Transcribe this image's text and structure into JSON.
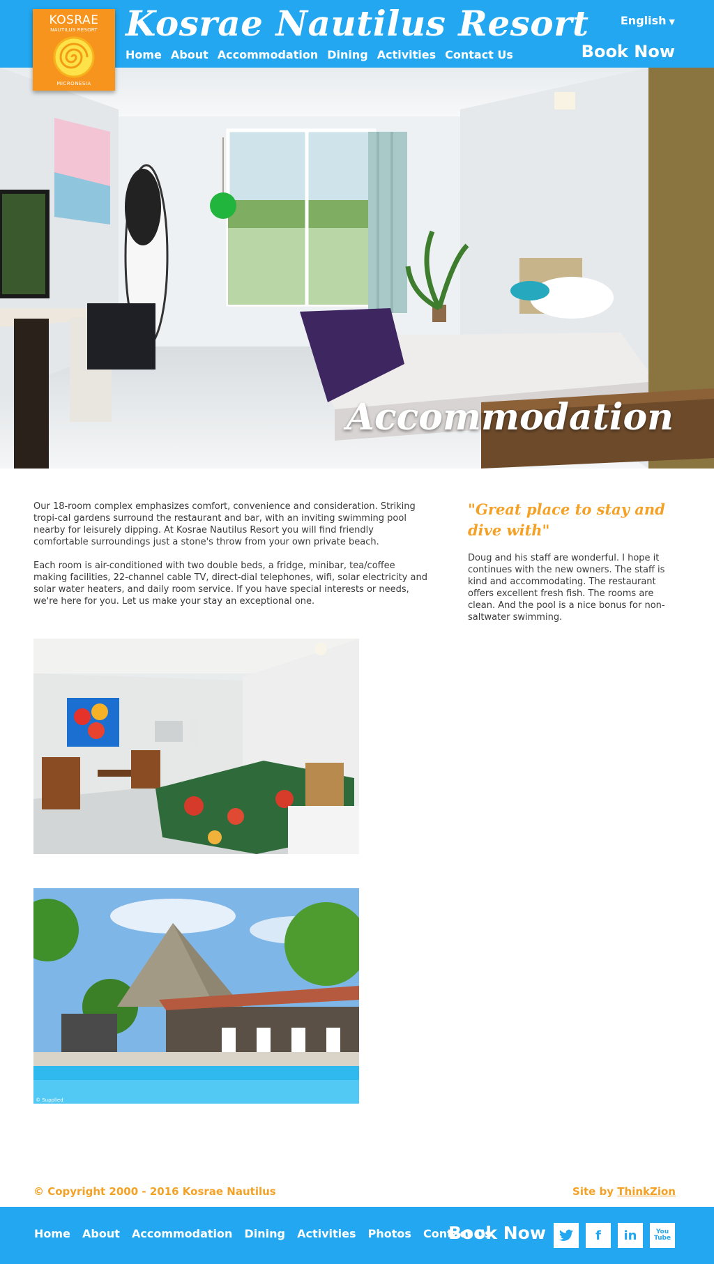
{
  "header": {
    "logo": {
      "line1": "KOSRAE",
      "line2": "NAUTILUS RESORT",
      "line3": "MICRONESIA"
    },
    "title": "Kosrae Nautilus Resort",
    "nav": [
      "Home",
      "About",
      "Accommodation",
      "Dining",
      "Activities",
      "Contact Us"
    ],
    "language": "English",
    "book_now": "Book Now"
  },
  "hero": {
    "title": "Accommodation"
  },
  "intro": {
    "paragraphs": [
      "Our 18-room complex emphasizes comfort, convenience and consideration. Striking tropi-cal gardens surround the restaurant and bar, with an inviting swimming pool nearby for leisurely dipping. At Kosrae Nautilus Resort you will find friendly comfortable surroundings just a stone's throw from your own private beach.",
      "Each room is air-conditioned with two double beds, a fridge, minibar, tea/coffee making facilities, 22-channel cable TV, direct-dial telephones, wifi, solar electricity and solar water heaters, and daily room service. If you have special interests or needs, we're here for you. Let us make your stay an exceptional one."
    ]
  },
  "review": {
    "title": "\"Great place to stay and dive with\"",
    "body": "Doug and his staff are wonderful. I hope it continues with the new owners. The staff is kind and accommodating. The restaurant offers excellent fresh fish. The rooms are clean. And the pool is a nice bonus for non-saltwater swimming."
  },
  "photos": {
    "credit": "© Supplied"
  },
  "footer": {
    "copyright": "© Copyright 2000 - 2016 Kosrae Nautilus",
    "site_by_prefix": "Site by ",
    "site_by_link": "ThinkZion",
    "nav": [
      "Home",
      "About",
      "Accommodation",
      "Dining",
      "Activities",
      "Photos",
      "Contact Us"
    ],
    "book_now": "Book Now",
    "social": [
      "twitter-icon",
      "facebook-icon",
      "linkedin-icon",
      "youtube-icon"
    ],
    "youtube_label_1": "You",
    "youtube_label_2": "Tube"
  },
  "colors": {
    "brand_blue": "#22a7f0",
    "accent_orange": "#f4a125",
    "logo_orange": "#f7941d"
  }
}
